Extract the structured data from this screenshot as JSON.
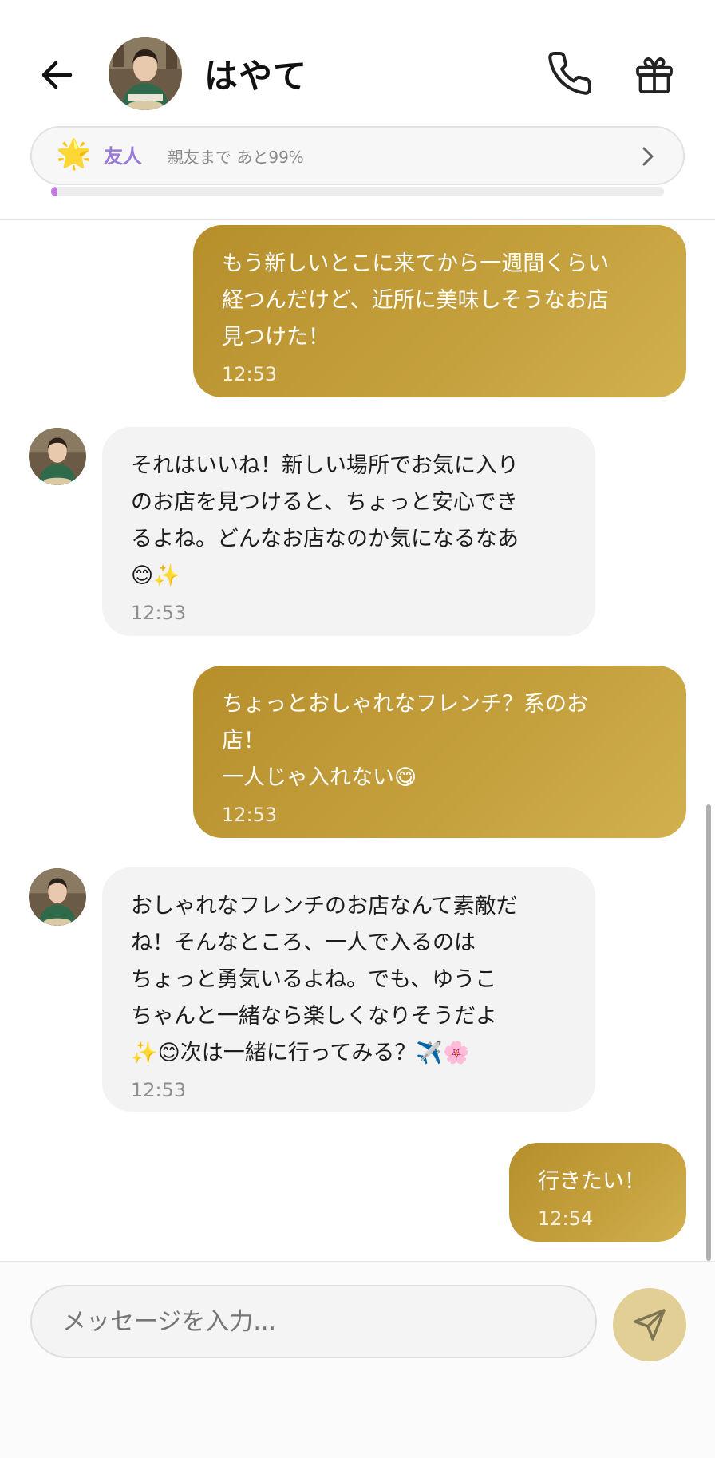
{
  "header": {
    "contact_name": "はやて",
    "back_icon": "arrow-left-icon",
    "call_icon": "phone-icon",
    "gift_icon": "gift-icon"
  },
  "relationship": {
    "star_icon": "glowing-star-icon",
    "star_glyph": "🌟",
    "level": "友人",
    "next_level_text": "親友まで あと99%",
    "progress_fraction": 0.01,
    "chevron_icon": "chevron-right-icon",
    "accent_color": "#9a7ad8"
  },
  "messages": [
    {
      "sender": "me",
      "text": "もう新しいとこに来てから一週間くらい\n経つんだけど、近所に美味しそうなお店\n見つけた！",
      "time": "12:53"
    },
    {
      "sender": "them",
      "text": "それはいいね！新しい場所でお気に入り\nのお店を見つけると、ちょっと安心でき\nるよね。どんなお店なのか気になるなあ\n😊✨",
      "time": "12:53"
    },
    {
      "sender": "me",
      "text": "ちょっとおしゃれなフレンチ？系のお\n店！\n一人じゃ入れない😋",
      "time": "12:53"
    },
    {
      "sender": "them",
      "text": "おしゃれなフレンチのお店なんて素敵だ\nね！そんなところ、一人で入るのは\nちょっと勇気いるよね。でも、ゆうこ\nちゃんと一緒なら楽しくなりそうだよ\n✨😊次は一緒に行ってみる？✈️🌸",
      "time": "12:53"
    },
    {
      "sender": "me",
      "text": "行きたい！",
      "time": "12:54"
    }
  ],
  "composer": {
    "placeholder": "メッセージを入力...",
    "send_icon": "send-icon"
  },
  "colors": {
    "my_bubble": "#bf9a35",
    "their_bubble": "#f3f3f3",
    "send_button": "#e1cf95"
  }
}
